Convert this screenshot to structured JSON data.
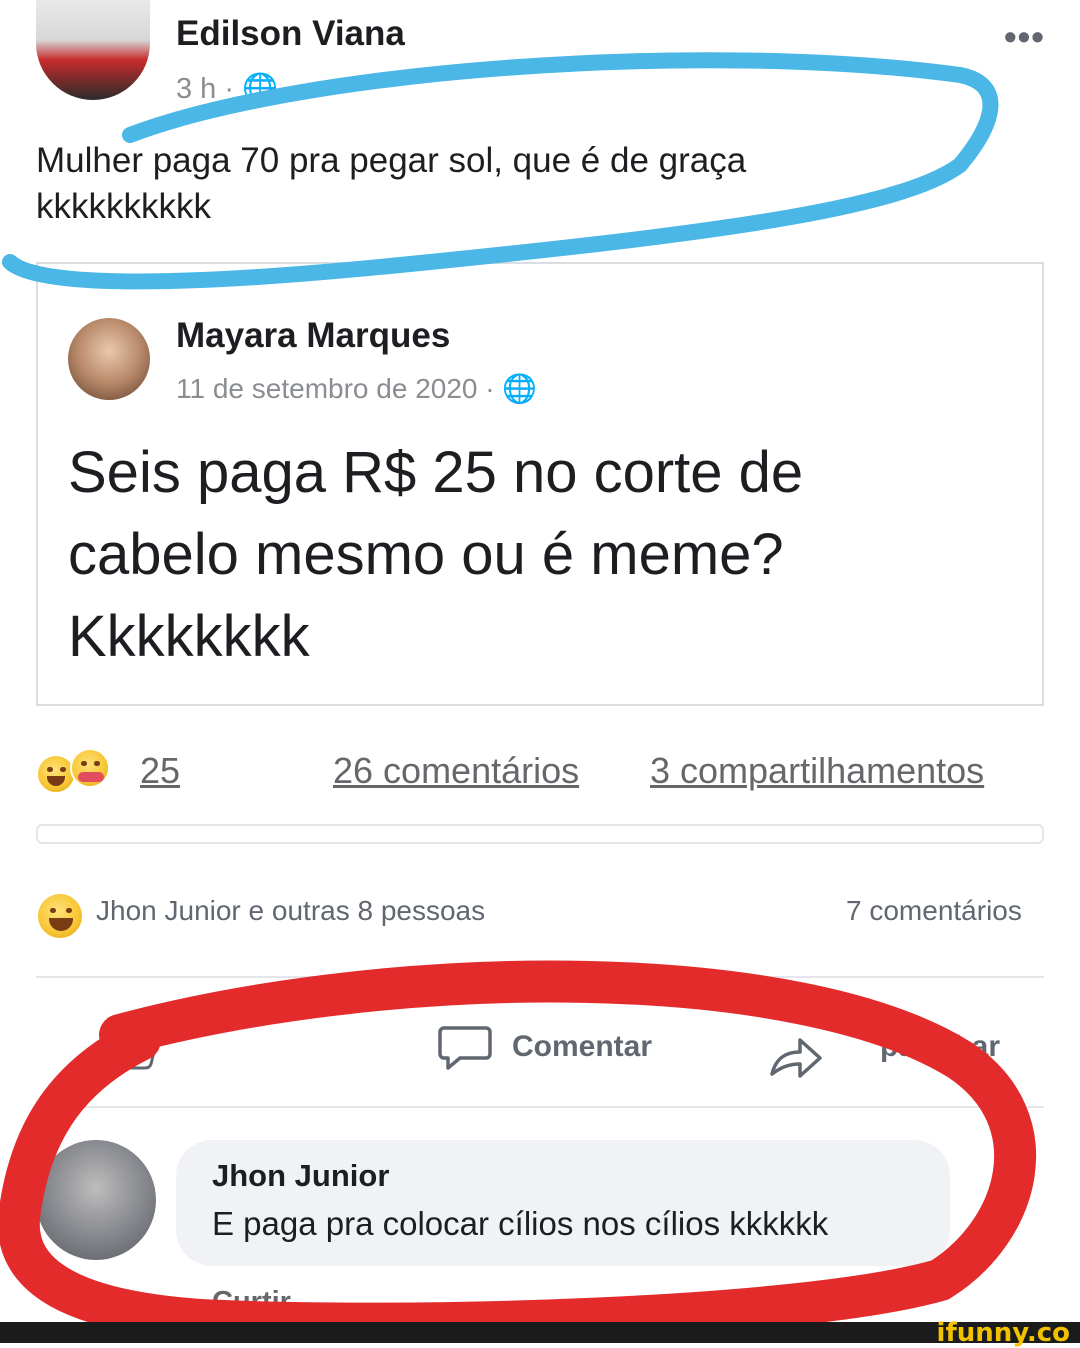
{
  "post": {
    "author": "Edilson Viana",
    "time": "3 h ·",
    "more_label": "•••",
    "text_line1": "Mulher paga 70 pra pegar sol, que é de graça",
    "text_line2": "kkkkkkkkkk"
  },
  "shared": {
    "author": "Mayara Marques",
    "date": "11 de setembro de 2020 · ",
    "text_line1": "Seis paga R$ 25 no corte de",
    "text_line2": "cabelo mesmo ou é meme?",
    "text_line3": "Kkkkkkkk"
  },
  "stats": {
    "reactions_count": "25",
    "comments": "26 comentários",
    "shares": "3 compartilhamentos"
  },
  "inner_post": {
    "liked_by": "Jhon Junior e outras 8 pessoas",
    "comments": "7 comentários",
    "like_label": "",
    "comment_label": "Comentar",
    "share_label": "partilhar"
  },
  "comment": {
    "author": "Jhon Junior",
    "text": "E paga pra colocar cílios nos cílios kkkkkk",
    "actions": "Curtir"
  },
  "colors": {
    "blue_annotation": "#4ab7e6",
    "red_annotation": "#e42b2b"
  },
  "watermark": "ifunny.co"
}
